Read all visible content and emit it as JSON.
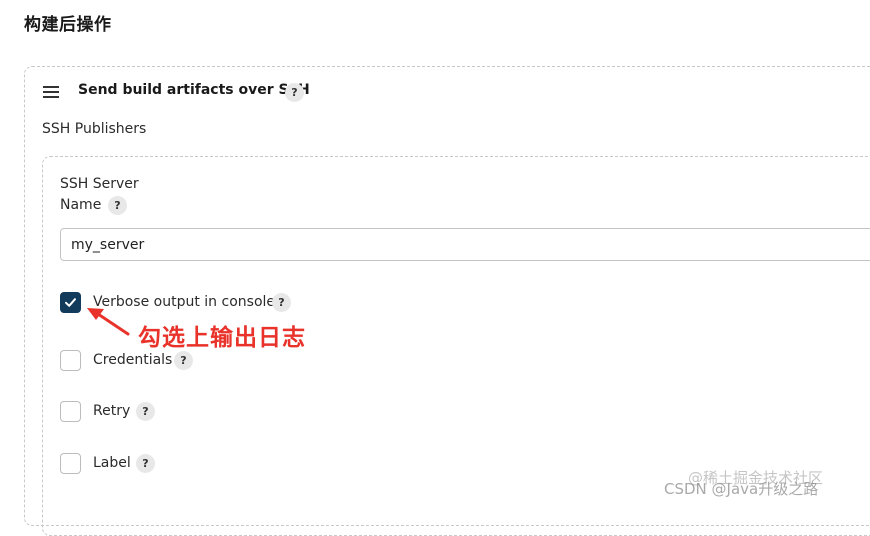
{
  "section": {
    "heading": "构建后操作"
  },
  "publisher": {
    "title": "Send build artifacts over SSH",
    "publishers_label": "SSH Publishers"
  },
  "server": {
    "name_label_line1": "SSH Server",
    "name_label_line2": "Name",
    "name_value": "my_server"
  },
  "options": [
    {
      "label": "Verbose output in console",
      "checked": true
    },
    {
      "label": "Credentials",
      "checked": false
    },
    {
      "label": "Retry",
      "checked": false
    },
    {
      "label": "Label",
      "checked": false
    }
  ],
  "help_glyph": "?",
  "annotation": {
    "text": "勾选上输出日志",
    "color": "#e8322a"
  },
  "watermark": {
    "line1": "@稀土掘金技术社区",
    "line2": "CSDN @Java升级之路"
  },
  "colors": {
    "checkbox_checked": "#123a5b",
    "help_badge_bg": "#e8e8e8",
    "panel_border": "#c8c8c8"
  }
}
